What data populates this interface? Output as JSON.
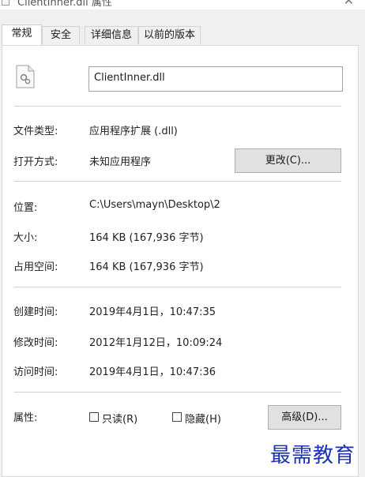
{
  "window": {
    "title": "ClientInner.dll 属性",
    "close_glyph": "✕"
  },
  "tabs": [
    {
      "label": "常规",
      "active": true
    },
    {
      "label": "安全",
      "active": false
    },
    {
      "label": "详细信息",
      "active": false
    },
    {
      "label": "以前的版本",
      "active": false
    }
  ],
  "file": {
    "icon": "dll-file-icon",
    "name": "ClientInner.dll"
  },
  "type_section": {
    "file_type_label": "文件类型:",
    "file_type_value": "应用程序扩展 (.dll)",
    "open_with_label": "打开方式:",
    "open_with_value": "未知应用程序",
    "change_button": "更改(C)..."
  },
  "location_section": {
    "location_label": "位置:",
    "location_value": "C:\\Users\\mayn\\Desktop\\2",
    "size_label": "大小:",
    "size_value": "164 KB (167,936 字节)",
    "size_on_disk_label": "占用空间:",
    "size_on_disk_value": "164 KB (167,936 字节)"
  },
  "dates_section": {
    "created_label": "创建时间:",
    "created_value": "2019年4月1日，10:47:35",
    "modified_label": "修改时间:",
    "modified_value": "2012年1月12日，10:09:24",
    "accessed_label": "访问时间:",
    "accessed_value": "2019年4月1日，10:47:36"
  },
  "attributes_section": {
    "label": "属性:",
    "readonly_label": "只读(R)",
    "readonly_checked": false,
    "hidden_label": "隐藏(H)",
    "hidden_checked": false,
    "advanced_button": "高级(D)..."
  },
  "watermark": {
    "text": "最需教育",
    "color": "#1c2fb8"
  }
}
